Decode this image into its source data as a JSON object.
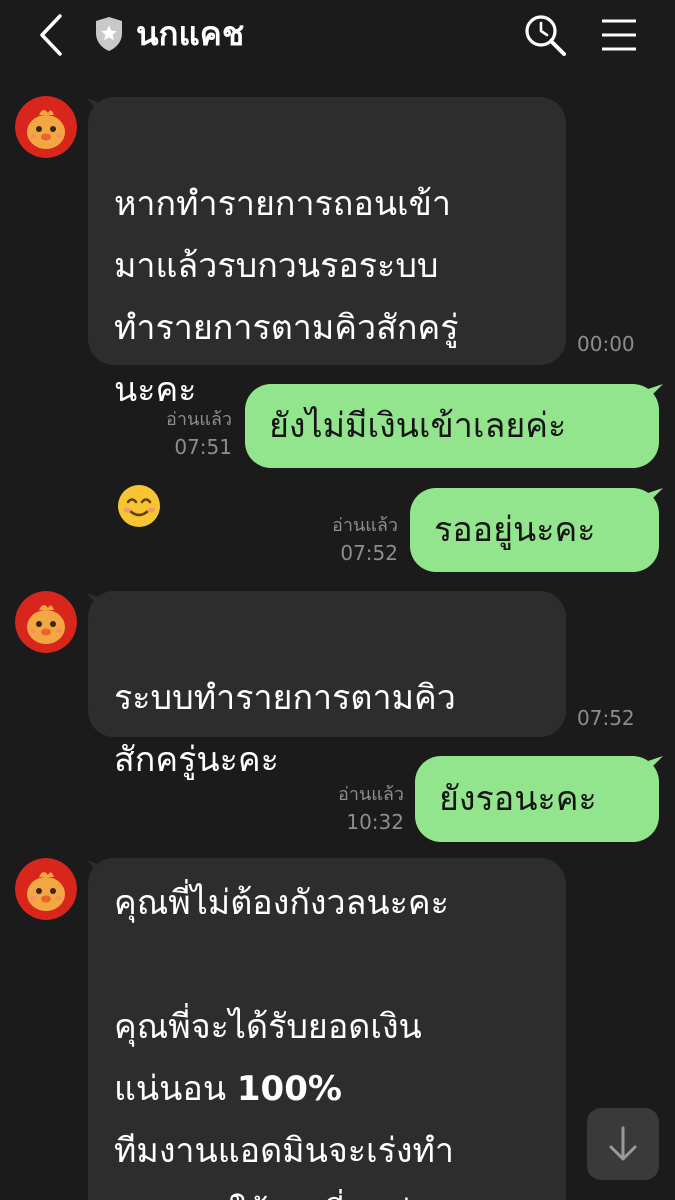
{
  "header": {
    "title": "นกแคช",
    "back_icon": "chevron-left-icon",
    "shield_icon": "shield-star-icon",
    "search_icon": "search-icon",
    "menu_icon": "hamburger-menu-icon"
  },
  "colors": {
    "background": "#1b1b1b",
    "incoming_bubble": "#2d2d2d",
    "outgoing_bubble": "#92e58c",
    "meta_text": "#8d8d8d"
  },
  "messages": [
    {
      "direction": "in",
      "text": "หากทำรายการถอนเข้า\nมาแล้วรบกวนรอระบบ\nทำรายการตามคิวสักครู่\nนะคะ",
      "emoji": "smiling-face-emoji",
      "time": "00:00"
    },
    {
      "direction": "out",
      "text": "ยังไม่มีเงินเข้าเลยค่ะ",
      "read": "อ่านแล้ว",
      "time": "07:51"
    },
    {
      "direction": "out",
      "text": "รออยู่นะคะ",
      "read": "อ่านแล้ว",
      "time": "07:52"
    },
    {
      "direction": "in",
      "text": "ระบบทำรายการตามคิว\nสักครู่นะคะ",
      "time": "07:52"
    },
    {
      "direction": "out",
      "text": "ยังรอนะคะ",
      "read": "อ่านแล้ว",
      "time": "10:32"
    },
    {
      "direction": "in",
      "line1": "คุณพี่ไม่ต้องกังวลนะคะ",
      "line2": "คุณพี่จะได้รับยอดเงิน",
      "line3a": "แน่นอน ",
      "line3b": "100%",
      "line4": "ทีมงานแอดมินจะเร่งทำ",
      "line5": "รายการให้คุณพี่ทุกท่าน"
    }
  ],
  "scroll_button": {
    "icon": "arrow-down-icon"
  }
}
